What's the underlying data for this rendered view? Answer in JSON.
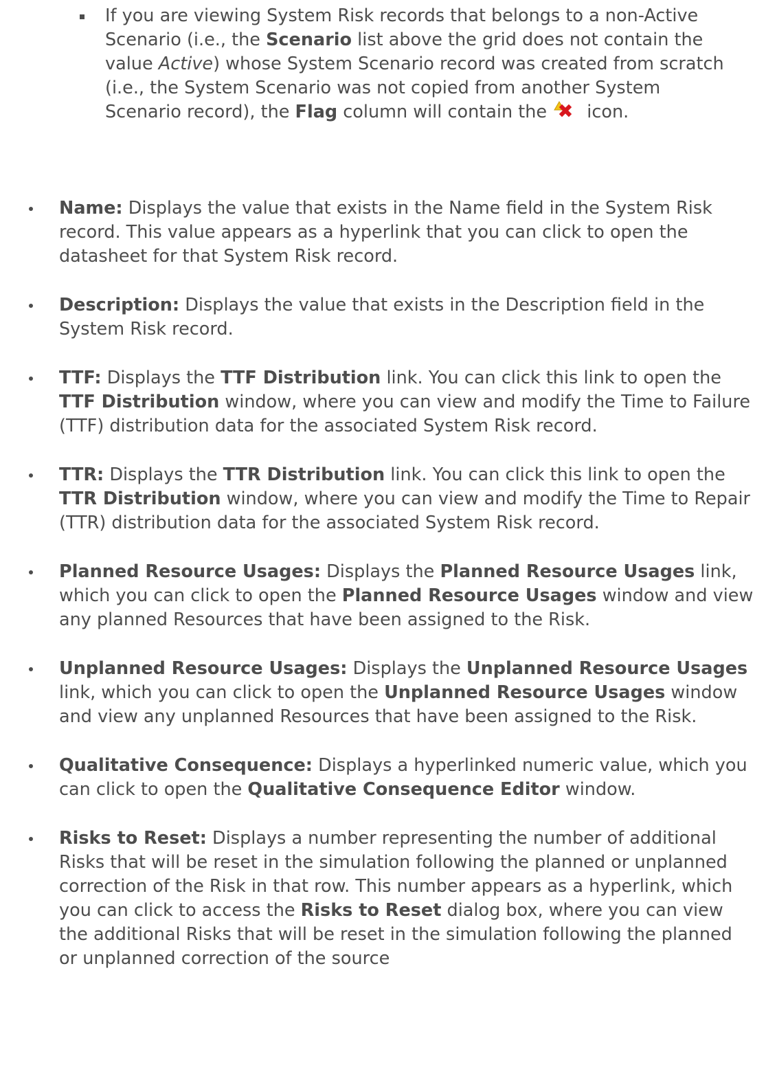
{
  "sub_bullet": {
    "t1": "If you are viewing System Risk records that belongs to a non-Active Scenario (i.e., the ",
    "scenario": "Scenario",
    "t2": " list above the grid does not contain the value ",
    "active": "Active",
    "t3": ") whose System Scenario record was created from scratch (i.e., the System Scenario was not copied from another System Scenario record), the ",
    "flag": "Flag",
    "t4": " column will contain the ",
    "icon": "warning-delete-icon",
    "t5": " icon."
  },
  "name": {
    "label": "Name:",
    "t1": " Displays the value that exists in the Name field in the System Risk record. This value appears as a hyperlink that you can click to open the datasheet for that System Risk record."
  },
  "description": {
    "label": "Description:",
    "t1": " Displays the value that exists in the Description field in the System Risk record."
  },
  "ttf": {
    "label": "TTF:",
    "t1": " Displays the ",
    "link": "TTF Distribution",
    "t2": " link. You can click this link to open the ",
    "window": "TTF Distribution",
    "t3": " window, where you can view and modify the Time to Failure (TTF) distribution data for the associated System Risk record."
  },
  "ttr": {
    "label": "TTR:",
    "t1": " Displays the ",
    "link": "TTR Distribution",
    "t2": " link. You can click this link to open the ",
    "window": "TTR Distribution",
    "t3": " window, where you can view and modify the Time to Repair (TTR) distribution data for the associated System Risk record."
  },
  "planned": {
    "label": "Planned Resource Usages:",
    "t1": " Displays the ",
    "link": "Planned Resource Usages",
    "t2": " link, which you can click to open the ",
    "window": "Planned Resource Usages",
    "t3": " window and view any planned Resources that have been assigned to the Risk."
  },
  "unplanned": {
    "label": "Unplanned Resource Usages:",
    "t1": " Displays the ",
    "link": "Unplanned Resource Usages",
    "t2": " link, which you can click to open the ",
    "window": "Unplanned Resource Usages",
    "t3": " window and view any unplanned Resources that have been assigned to the Risk."
  },
  "qualitative": {
    "label": "Qualitative Consequence:",
    "t1": " Displays a hyperlinked numeric value, which you can click to open the ",
    "window": "Qualitative Consequence Editor",
    "t2": " window."
  },
  "reset": {
    "label": "Risks to Reset:",
    "t1": " Displays a number representing the number of additional Risks that will be reset in the simulation following the planned or unplanned correction of the Risk in that row. This number appears as a hyperlink, which you can click to access the ",
    "dialog": "Risks to Reset",
    "t2": " dialog box, where you can view the additional Risks that will be reset in the simulation following the planned or unplanned correction of the source"
  },
  "colors": {
    "text": "#4d4d4d",
    "icon_red": "#d8171e",
    "icon_yellow": "#f3c317"
  }
}
